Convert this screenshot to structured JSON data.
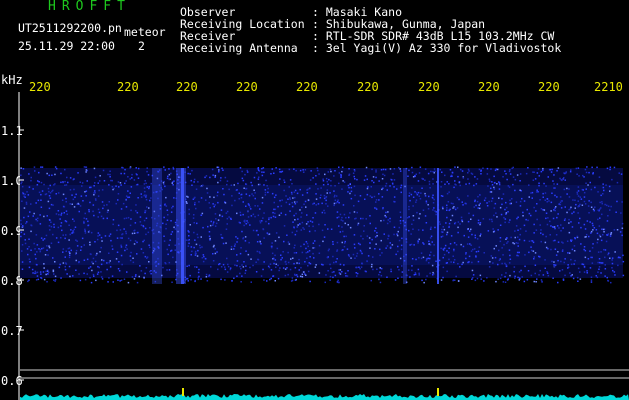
{
  "header": {
    "brand": "HROFFT",
    "filename": "UT2511292200.pn",
    "datetime": "25.11.29 22:00",
    "counter": "2",
    "mode_label": "meteor",
    "fields": [
      {
        "label": "Observer",
        "value": ": Masaki Kano"
      },
      {
        "label": "Receiving Location",
        "value": ": Shibukawa, Gunma, Japan"
      },
      {
        "label": "Receiver",
        "value": ": RTL-SDR SDR# 43dB L15 103.2MHz CW"
      },
      {
        "label": "Receiving Antenna",
        "value": ": 3el Yagi(V) Az 330 for Vladivostok"
      }
    ]
  },
  "axis": {
    "unit_label": "kHz",
    "y_ticks": [
      "1.1",
      "1.0",
      "0.9",
      "0.8",
      "0.7",
      "0.6"
    ],
    "x_ticks": [
      "220",
      "220",
      "220",
      "220",
      "220",
      "220",
      "220",
      "220",
      "220",
      "2210"
    ]
  },
  "colors": {
    "text": "#ffffff",
    "accent": "#e8e800",
    "brand": "#1ec81e",
    "signal": "#2a3cff",
    "noise_floor": "#00d8d8"
  }
}
